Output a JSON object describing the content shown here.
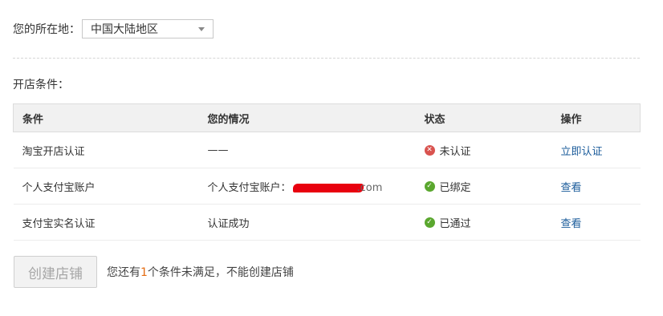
{
  "location": {
    "label": "您的所在地：",
    "selected": "中国大陆地区"
  },
  "conditions": {
    "title": "开店条件：",
    "headers": [
      "条件",
      "您的情况",
      "状态",
      "操作"
    ],
    "rows": [
      {
        "condition": "淘宝开店认证",
        "situation": "——",
        "status": "未认证",
        "status_icon": "x-circle-icon",
        "action": "立即认证"
      },
      {
        "condition": "个人支付宝账户",
        "situation_prefix": "个人支付宝账户：",
        "situation_suffix": ".com",
        "status": "已绑定",
        "status_icon": "check-circle-icon",
        "action": "查看"
      },
      {
        "condition": "支付宝实名认证",
        "situation": "认证成功",
        "status": "已通过",
        "status_icon": "check-circle-icon",
        "action": "查看"
      }
    ]
  },
  "footer": {
    "create_button": "创建店铺",
    "hint_before": "您还有",
    "hint_count": "1",
    "hint_after": "个条件未满足，不能创建店铺"
  },
  "colors": {
    "link": "#1a5b9a",
    "error": "#d9534f",
    "success": "#5aa72e",
    "highlight": "#e46b11"
  }
}
